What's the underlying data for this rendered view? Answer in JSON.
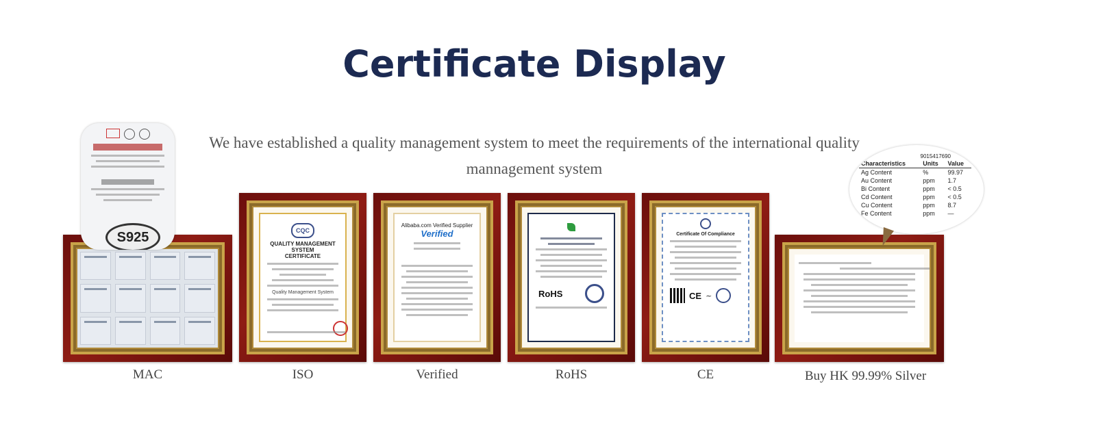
{
  "header": {
    "title": "Certificate Display",
    "subtitle": "We have established a quality management system to meet the requirements of the international quality mannagement system"
  },
  "certificates": [
    {
      "caption": "MAC"
    },
    {
      "caption": "ISO",
      "logo": "CQC",
      "heading": "QUALITY MANAGEMENT SYSTEM",
      "subheading": "CERTIFICATE",
      "footer": "Quality Management System"
    },
    {
      "caption": "Verified",
      "heading": "Alibaba.com Verified Supplier",
      "badge": "Verified"
    },
    {
      "caption": "RoHS",
      "mark": "RoHS"
    },
    {
      "caption": "CE",
      "heading": "Certificate Of Compliance",
      "mark": "CE"
    },
    {
      "caption": "Buy HK 99.99% Silver"
    }
  ],
  "overlays": {
    "mac_stamp": "S925",
    "silver_report": {
      "number": "9015417690",
      "columns": [
        "Characteristics",
        "Units",
        "Value"
      ],
      "rows": [
        [
          "Ag Content",
          "%",
          "99.97"
        ],
        [
          "Au Content",
          "ppm",
          "1.7"
        ],
        [
          "Bi Content",
          "ppm",
          "< 0.5"
        ],
        [
          "Cd Content",
          "ppm",
          "< 0.5"
        ],
        [
          "Cu Content",
          "ppm",
          "8.7"
        ],
        [
          "Fe Content",
          "ppm",
          "—"
        ]
      ]
    }
  },
  "colors": {
    "title": "#1c2a52",
    "frame": "#7a1410",
    "gold": "#c9a349"
  }
}
